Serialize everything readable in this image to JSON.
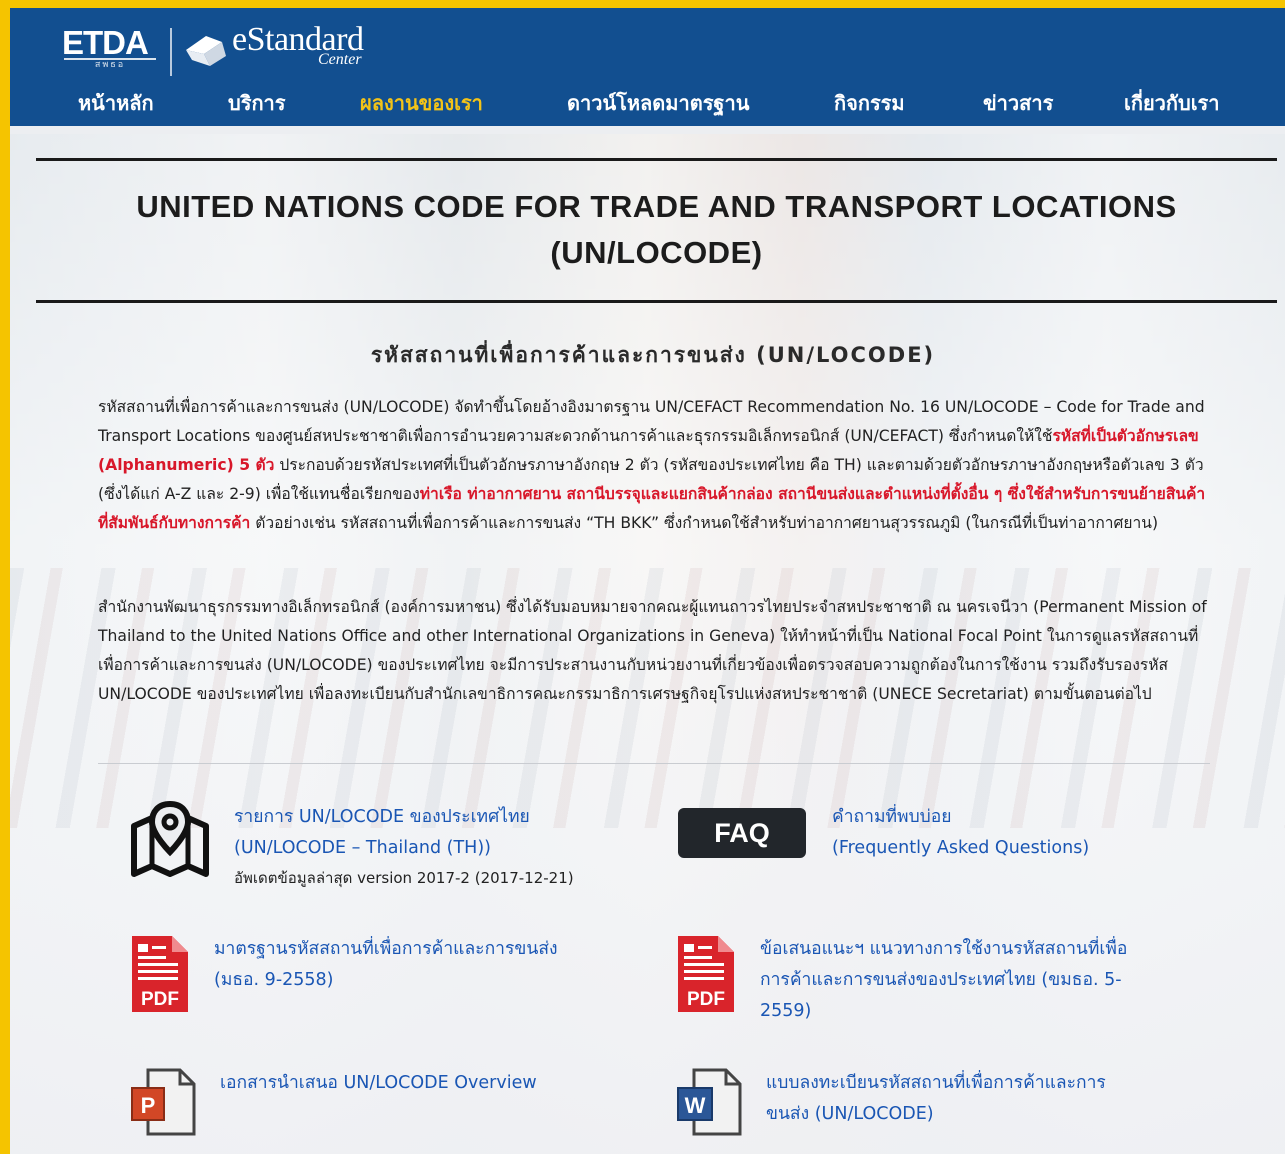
{
  "header": {
    "logo_etda": "ETDA",
    "logo_etda_sub": "สพธอ",
    "logo_estandard": "eStandard",
    "logo_center": "Center"
  },
  "nav": {
    "items": [
      {
        "label": "หน้าหลัก"
      },
      {
        "label": "บริการ"
      },
      {
        "label": "ผลงานของเรา"
      },
      {
        "label": "ดาวน์โหลดมาตรฐาน"
      },
      {
        "label": "กิจกรรม"
      },
      {
        "label": "ข่าวสาร"
      },
      {
        "label": "เกี่ยวกับเรา"
      }
    ],
    "active_index": 2
  },
  "page": {
    "title_line1": "UNITED NATIONS CODE FOR TRADE AND TRANSPORT LOCATIONS",
    "title_line2": "(UN/LOCODE)",
    "sub_heading": "รหัสสถานที่เพื่อการค้าและการขนส่ง (UN/LOCODE)",
    "para1": {
      "p1": "รหัสสถานที่เพื่อการค้าและการขนส่ง (UN/LOCODE) จัดทำขึ้นโดยอ้างอิงมาตรฐาน UN/CEFACT Recommendation No. 16 UN/LOCODE – Code for Trade and Transport Locations ของศูนย์สหประชาชาติเพื่อการอำนวยความสะดวกด้านการค้าและธุรกรรมอิเล็กทรอนิกส์ (UN/CEFACT) ซึ่งกำหนดให้ใช้",
      "h1": "รหัสที่เป็นตัวอักษรเลข (Alphanumeric) 5 ตัว",
      "p2": " ประกอบด้วยรหัสประเทศที่เป็นตัวอักษรภาษาอังกฤษ 2 ตัว (รหัสของประเทศไทย คือ TH) และตามด้วยตัวอักษรภาษาอังกฤษหรือตัวเลข 3 ตัว (ซึ่งได้แก่ A-Z และ 2-9) เพื่อใช้แทนชื่อเรียกของ",
      "h2": "ท่าเรือ ท่าอากาศยาน สถานีบรรจุและแยกสินค้ากล่อง สถานีขนส่งและตำแหน่งที่ตั้งอื่น ๆ ซึ่งใช้สำหรับการขนย้ายสินค้าที่สัมพันธ์กับทางการค้า",
      "p3": " ตัวอย่างเช่น รหัสสถานที่เพื่อการค้าและการขนส่ง “TH BKK” ซึ่งกำหนดใช้สำหรับท่าอากาศยานสุวรรณภูมิ (ในกรณีที่เป็นท่าอากาศยาน)"
    },
    "para2": "สำนักงานพัฒนาธุรกรรมทางอิเล็กทรอนิกส์ (องค์การมหาชน) ซึ่งได้รับมอบหมายจากคณะผู้แทนถาวรไทยประจำสหประชาชาติ ณ นครเจนีวา (Permanent Mission of Thailand to the United Nations Office and other International Organizations in Geneva) ให้ทำหน้าที่เป็น National Focal Point ในการดูแลรหัสสถานที่เพื่อการค้าและการขนส่ง (UN/LOCODE) ของประเทศไทย จะมีการประสานงานกับหน่วยงานที่เกี่ยวข้องเพื่อตรวจสอบความถูกต้องในการใช้งาน รวมถึงรับรองรหัส UN/LOCODE ของประเทศไทย เพื่อลงทะเบียนกับสำนักเลขาธิการคณะกรรมาธิการเศรษฐกิจยุโรปแห่งสหประชาชาติ (UNECE Secretariat) ตามขั้นตอนต่อไป"
  },
  "links": {
    "locode_list": {
      "line1": "รายการ UN/LOCODE ของประเทศไทย",
      "line2": "(UN/LOCODE – Thailand (TH))",
      "note": "อัพเดตข้อมูลล่าสุด version 2017-2 (2017-12-21)"
    },
    "faq": {
      "badge": "FAQ",
      "line1": "คำถามที่พบบ่อย",
      "line2": "(Frequently Asked Questions)"
    },
    "standard_pdf": {
      "line1": "มาตรฐานรหัสสถานที่เพื่อการค้าและการขนส่ง",
      "line2": "(มธอ. 9-2558)"
    },
    "guideline_pdf": {
      "line1": "ข้อเสนอแนะฯ แนวทางการใช้งานรหัสสถานที่เพื่อ",
      "line2": "การค้าและการขนส่งของประเทศไทย (ขมธอ. 5-",
      "line3": "2559)"
    },
    "overview_ppt": {
      "line1": "เอกสารนำเสนอ UN/LOCODE Overview"
    },
    "register_doc": {
      "line1": "แบบลงทะเบียนรหัสสถานที่เพื่อการค้าและการ",
      "line2": "ขนส่ง (UN/LOCODE)"
    }
  },
  "icons": {
    "pdf_label": "PDF",
    "ppt_letter": "P",
    "word_letter": "W"
  },
  "colors": {
    "header_bg": "#124f90",
    "nav_active": "#f3c318",
    "link": "#1a56b4",
    "highlight_red": "#d8172a",
    "pdf_red": "#d9242b",
    "border_yellow": "#f5c400"
  }
}
